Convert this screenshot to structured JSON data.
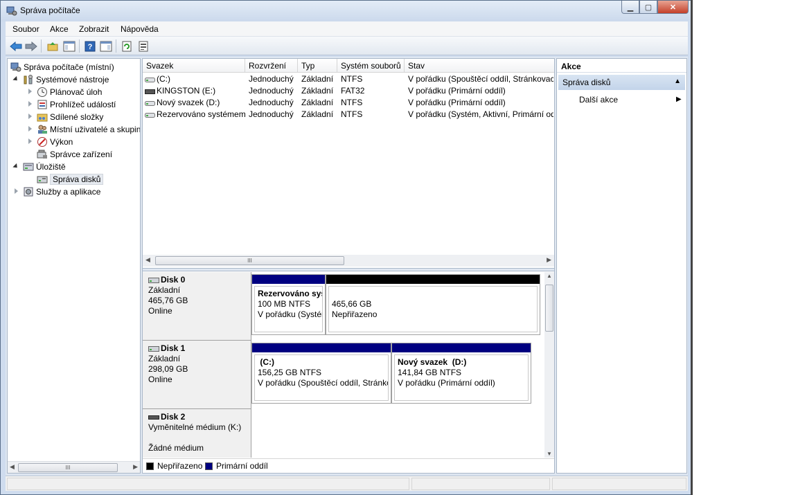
{
  "window": {
    "title": "Správa počítače"
  },
  "menu": [
    "Soubor",
    "Akce",
    "Zobrazit",
    "Nápověda"
  ],
  "toolbar": {
    "icons": [
      "back-arrow-icon",
      "forward-arrow-icon",
      "up-folder-icon",
      "show-hide-tree-icon",
      "help-icon",
      "show-hide-action-icon",
      "refresh-icon",
      "properties-icon"
    ]
  },
  "tree": [
    {
      "label": "Správa počítače (místní)",
      "icon": "computer-management-icon",
      "level": 0,
      "expander": "none"
    },
    {
      "label": "Systémové nástroje",
      "icon": "tools-icon",
      "level": 1,
      "expander": "open"
    },
    {
      "label": "Plánovač úloh",
      "icon": "clock-icon",
      "level": 2,
      "expander": "closed"
    },
    {
      "label": "Prohlížeč událostí",
      "icon": "event-viewer-icon",
      "level": 2,
      "expander": "closed"
    },
    {
      "label": "Sdílené složky",
      "icon": "shared-folder-icon",
      "level": 2,
      "expander": "closed"
    },
    {
      "label": "Místní uživatelé a skupiny",
      "icon": "users-icon",
      "level": 2,
      "expander": "closed"
    },
    {
      "label": "Výkon",
      "icon": "performance-icon",
      "level": 2,
      "expander": "closed"
    },
    {
      "label": "Správce zařízení",
      "icon": "device-manager-icon",
      "level": 2,
      "expander": "none"
    },
    {
      "label": "Úložiště",
      "icon": "storage-icon",
      "level": 1,
      "expander": "open"
    },
    {
      "label": "Správa disků",
      "icon": "disk-management-icon",
      "level": 2,
      "expander": "none",
      "selected": true
    },
    {
      "label": "Služby a aplikace",
      "icon": "services-icon",
      "level": 1,
      "expander": "closed"
    }
  ],
  "volumes": {
    "columns": [
      "Svazek",
      "Rozvržení",
      "Typ",
      "Systém souborů",
      "Stav"
    ],
    "rows": [
      {
        "name": "(C:)",
        "icon": "drive-icon",
        "layout": "Jednoduchý",
        "type": "Základní",
        "fs": "NTFS",
        "status": "V pořádku (Spouštěcí oddíl, Stránkovací"
      },
      {
        "name": "KINGSTON (E:)",
        "icon": "removable-drive-icon",
        "layout": "Jednoduchý",
        "type": "Základní",
        "fs": "FAT32",
        "status": "V pořádku (Primární oddíl)"
      },
      {
        "name": "Nový svazek (D:)",
        "icon": "drive-icon",
        "layout": "Jednoduchý",
        "type": "Základní",
        "fs": "NTFS",
        "status": "V pořádku (Primární oddíl)"
      },
      {
        "name": "Rezervováno systémem",
        "icon": "drive-icon",
        "layout": "Jednoduchý",
        "type": "Základní",
        "fs": "NTFS",
        "status": "V pořádku (Systém, Aktivní, Primární odd"
      }
    ]
  },
  "disks": [
    {
      "name": "Disk 0",
      "type": "Základní",
      "size": "465,76 GB",
      "state": "Online",
      "partitions": [
        {
          "title": "Rezervováno sys",
          "line1": "100 MB NTFS",
          "line2": "V pořádku (Systér",
          "bar": "#000080"
        },
        {
          "title": "",
          "line1": "465,66 GB",
          "line2": "Nepřiřazeno",
          "bar": "#000000"
        }
      ]
    },
    {
      "name": "Disk 1",
      "type": "Základní",
      "size": "298,09 GB",
      "state": "Online",
      "partitions": [
        {
          "title": " (C:)",
          "line1": "156,25 GB NTFS",
          "line2": "V pořádku (Spouštěcí oddíl, Stránko",
          "bar": "#000080"
        },
        {
          "title": "Nový svazek  (D:)",
          "line1": "141,84 GB NTFS",
          "line2": "V pořádku (Primární oddíl)",
          "bar": "#000080"
        }
      ]
    },
    {
      "name": "Disk 2",
      "type": "Vyměnitelné médium (K:)",
      "state": "Žádné médium"
    }
  ],
  "legend": [
    {
      "label": "Nepřiřazeno",
      "color": "#000000"
    },
    {
      "label": "Primární oddíl",
      "color": "#000080"
    }
  ],
  "actions": {
    "header": "Akce",
    "section": "Správa disků",
    "item": "Další akce"
  },
  "scroll": {
    "grip": "III"
  }
}
